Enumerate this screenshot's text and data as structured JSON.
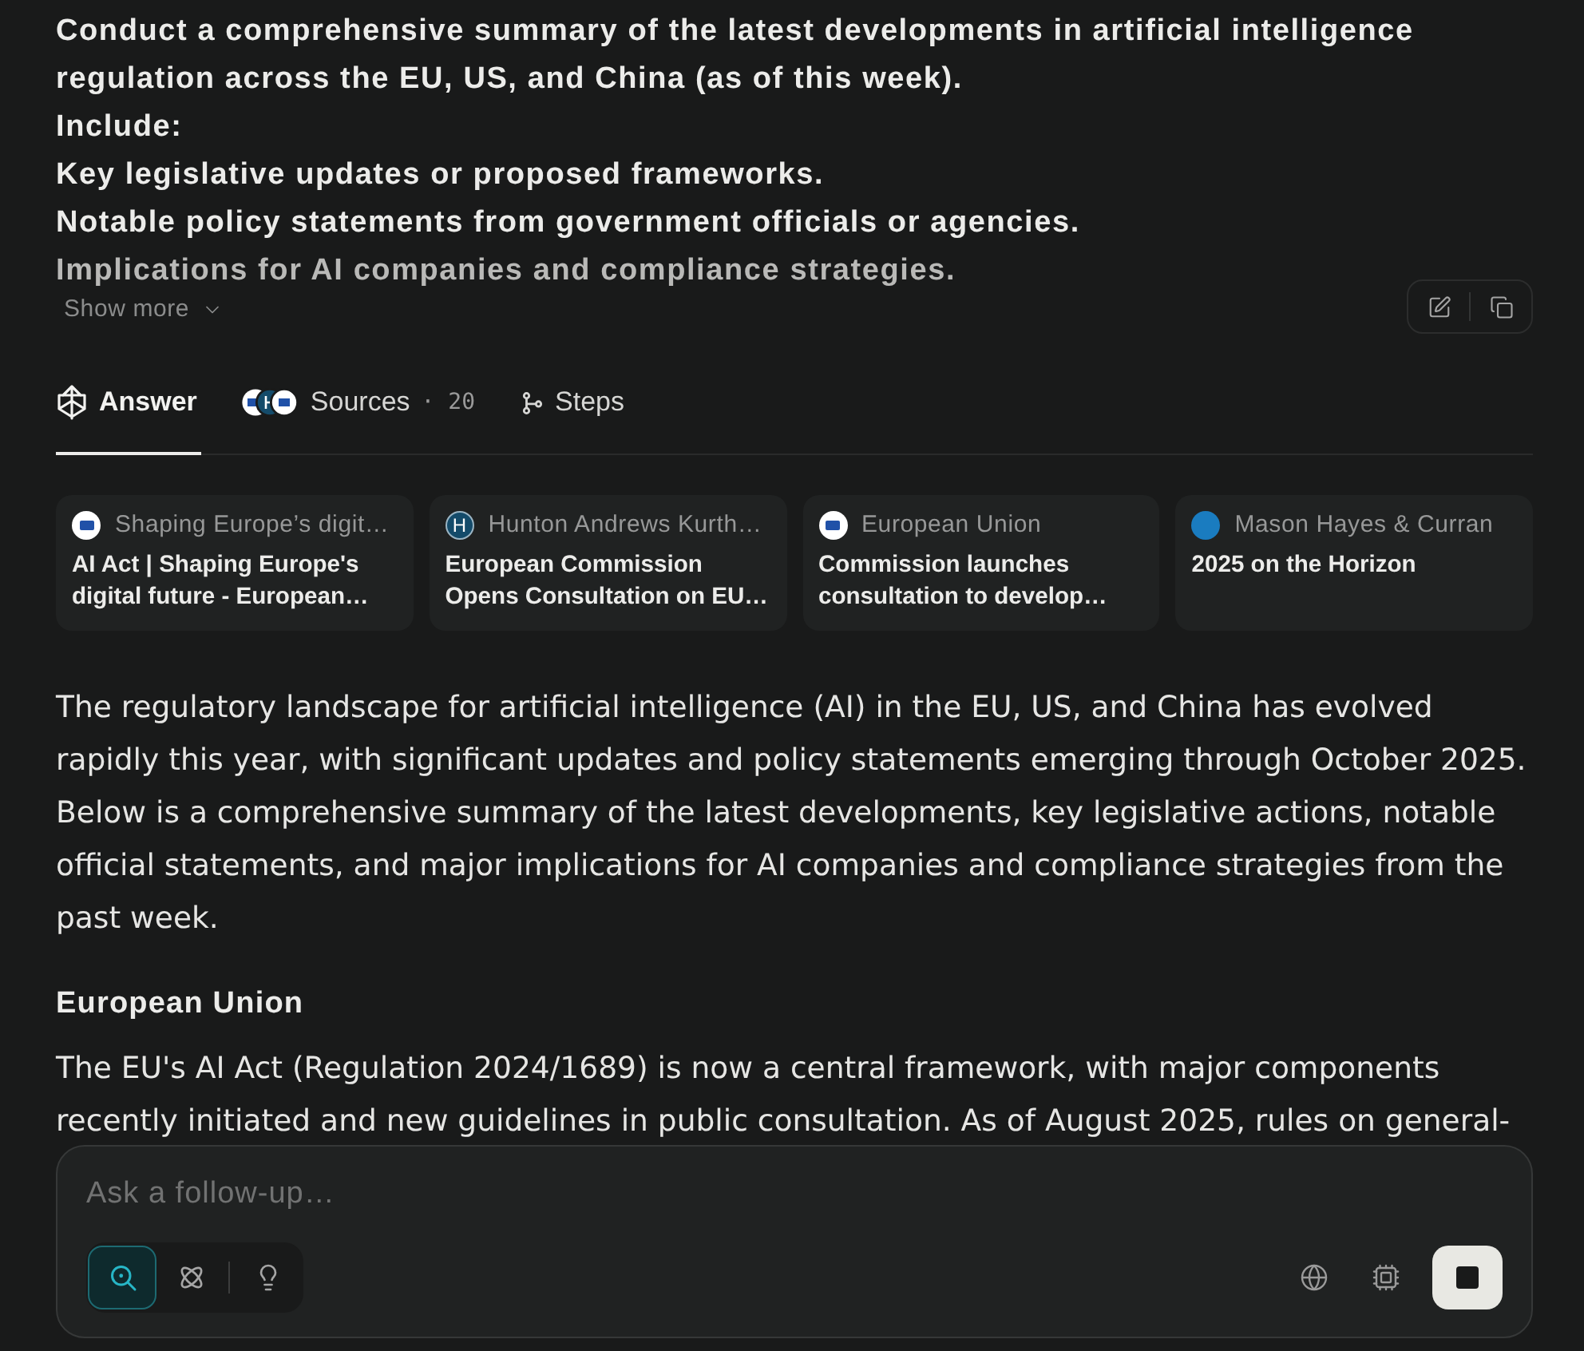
{
  "prompt": {
    "lines": [
      "Conduct a comprehensive summary of the latest developments in artificial intelligence regulation across the EU, US, and China (as of this week).",
      "Include:",
      "Key legislative updates or proposed frameworks.",
      "Notable policy statements from government officials or agencies.",
      "Implications for AI companies and compliance strategies."
    ],
    "show_more": "Show more"
  },
  "tabs": [
    {
      "kind": "answer",
      "label": "Answer",
      "selected": true
    },
    {
      "kind": "sources",
      "label": "Sources",
      "count": "· 20",
      "selected": false
    },
    {
      "kind": "steps",
      "label": "Steps",
      "selected": false
    }
  ],
  "source_cards": [
    {
      "favicon": {
        "kind": "flag"
      },
      "site": "Shaping Europe’s digit…",
      "title": "AI Act | Shaping Europe's digital future - European…"
    },
    {
      "favicon": {
        "kind": "letter",
        "text": "H"
      },
      "site": "Hunton Andrews Kurth…",
      "title": "European Commission Opens Consultation on EU…"
    },
    {
      "favicon": {
        "kind": "flag"
      },
      "site": "European Union",
      "title": "Commission launches consultation to develop…"
    },
    {
      "favicon": {
        "kind": "badge"
      },
      "site": "Mason Hayes & Curran",
      "title": "2025 on the Horizon"
    }
  ],
  "answer": {
    "intro": "The regulatory landscape for artificial intelligence (AI) in the EU, US, and China has evolved rapidly this year, with significant updates and policy statements emerging through October 2025. Below is a comprehensive summary of the latest developments, key legislative actions, notable official statements, and major implications for AI companies and compliance strategies from the past week.",
    "sections": [
      {
        "heading": "European Union",
        "paragraph": "The EU's AI Act (Regulation 2024/1689) is now a central framework, with major components recently initiated and new guidelines in public consultation. As of August 2025, rules on general-"
      }
    ]
  },
  "composer": {
    "placeholder": "Ask a follow-up…",
    "modes": [
      {
        "kind": "search",
        "selected": true
      },
      {
        "kind": "research",
        "selected": false
      },
      {
        "kind": "labs",
        "selected": false
      }
    ]
  }
}
